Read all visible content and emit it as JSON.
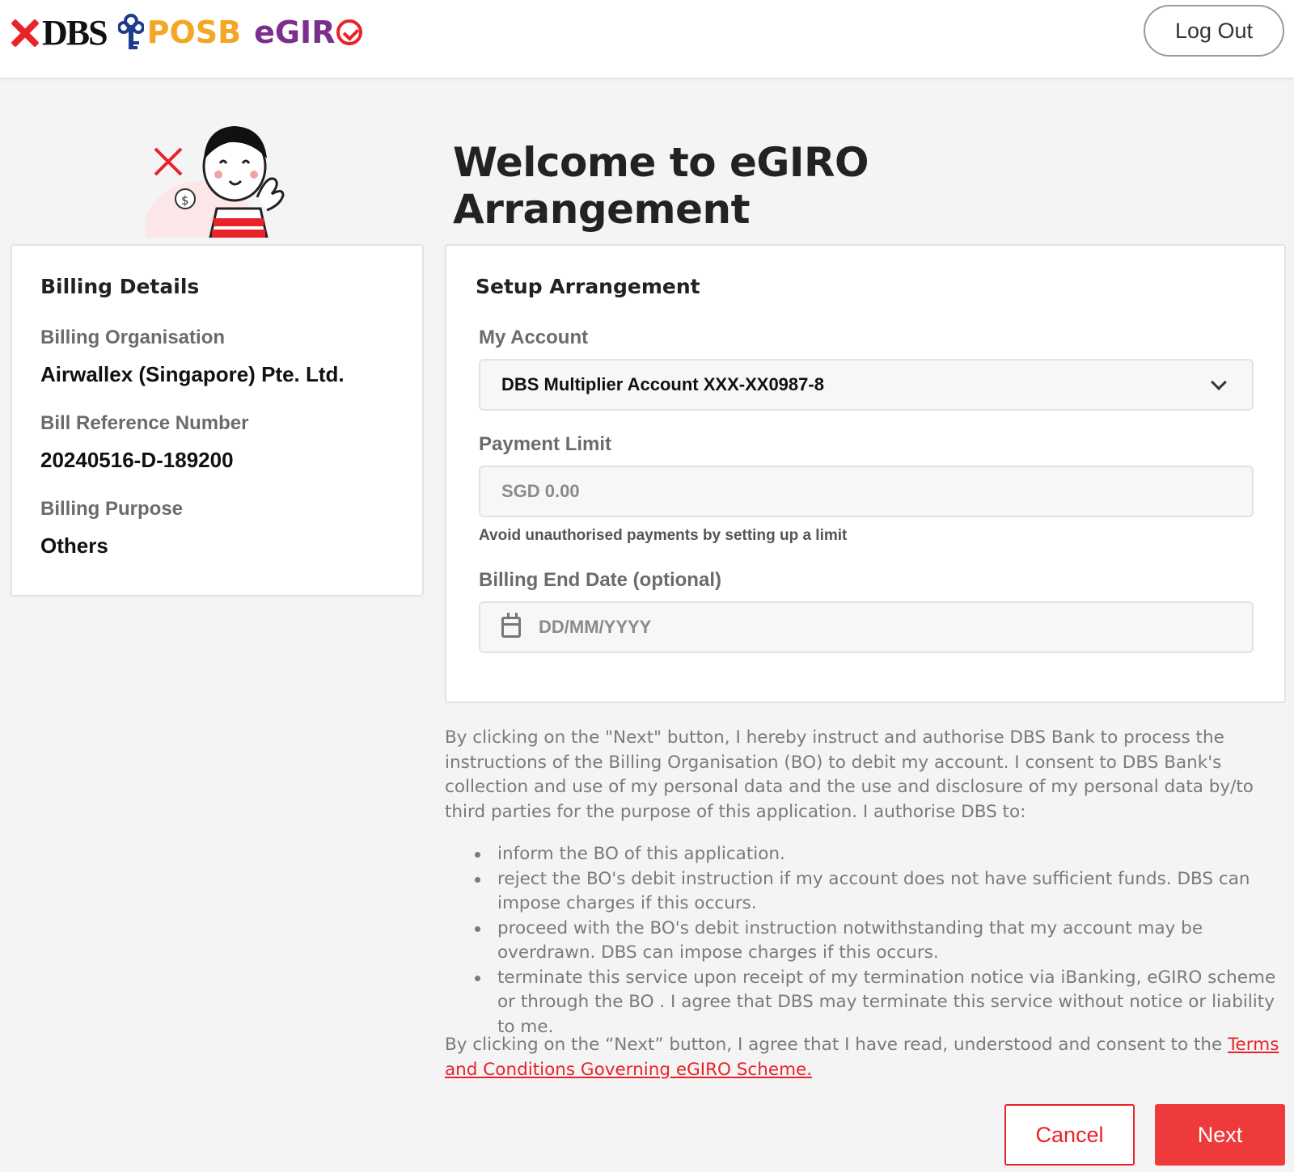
{
  "header": {
    "logo_dbs": "DBS",
    "logo_posb": "POSB",
    "logo_egiro": "eGIR",
    "logout_label": "Log Out"
  },
  "page_title": "Welcome to eGIRO Arrangement",
  "billing": {
    "heading": "Billing Details",
    "organisation_label": "Billing Organisation",
    "organisation_value": "Airwallex (Singapore) Pte. Ltd.",
    "reference_label": "Bill Reference Number",
    "reference_value": "20240516-D-189200",
    "purpose_label": "Billing Purpose",
    "purpose_value": "Others"
  },
  "setup": {
    "heading": "Setup Arrangement",
    "account_label": "My Account",
    "account_selected": "DBS Multiplier Account XXX-XX0987-8",
    "limit_label": "Payment Limit",
    "limit_placeholder": "SGD 0.00",
    "limit_hint": "Avoid unauthorised payments by setting up a limit",
    "end_date_label": "Billing End Date (optional)",
    "end_date_placeholder": "DD/MM/YYYY"
  },
  "consent": {
    "intro": "By clicking on the \"Next\" button, I hereby instruct and authorise DBS Bank to process the instructions of the Billing Organisation (BO) to debit my account. I consent to DBS Bank's collection and use of my personal data and the use and disclosure of my personal data by/to third parties for the purpose of this application. I authorise DBS to:",
    "items": [
      "inform the BO of this application.",
      "reject the BO's debit instruction if my account does not have sufficient funds. DBS can impose charges if this occurs.",
      "proceed with the BO's debit instruction notwithstanding that my account may be overdrawn. DBS can impose charges if this occurs.",
      "terminate this service upon receipt of my termination notice via iBanking, eGIRO scheme or through the BO . I agree that DBS may terminate this service without notice or liability to me."
    ],
    "final_text": "By clicking on the “Next” button, I agree that I have read, understood and consent to the ",
    "terms_link": "Terms and Conditions Governing eGIRO Scheme."
  },
  "actions": {
    "cancel_label": "Cancel",
    "next_label": "Next"
  },
  "colors": {
    "brand_red": "#e8232a",
    "posb_orange": "#f5a623",
    "egiro_purple": "#7b2e8e"
  }
}
